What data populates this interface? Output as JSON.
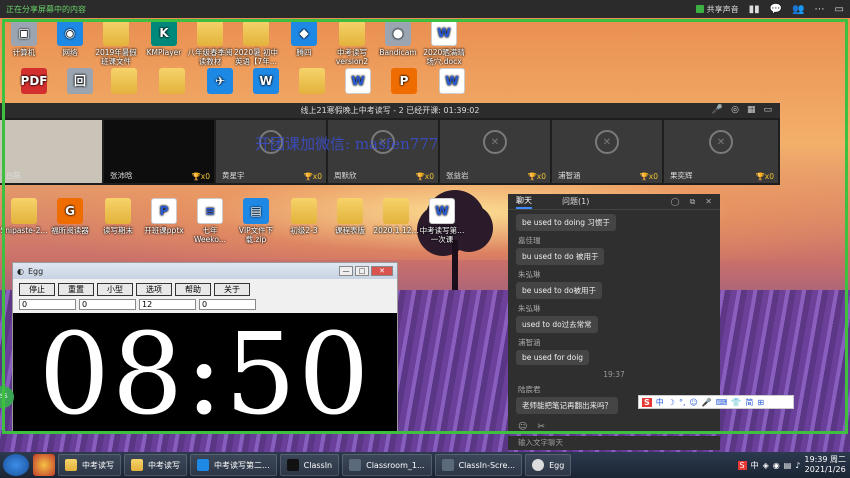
{
  "share_bar": {
    "note": "正在分享屏幕中的内容",
    "sound_label": "共享声音"
  },
  "desktop": {
    "row1": [
      "计算机",
      "网络",
      "2019年暑假班课文件",
      "KMPlayer",
      "八年级春季阅读教材",
      "2020暑 初中英语【7年...",
      "腾四",
      "中考读写version2",
      "Bandicam",
      "2020晒满晴场穴.docx"
    ],
    "row3": [
      "Snipaste-2...",
      "福昕阅读器",
      "读写期末",
      "开班课pptx",
      "七年 Weeko...",
      "VIP文件下载.zip",
      "初级2-3",
      "课程表版",
      "2020.1.12...",
      "中考读写第...一次课"
    ],
    "row2_badges": [
      "PDF",
      "回",
      "W",
      "W"
    ]
  },
  "video": {
    "title": "线上21寒假晚上中考读写 - 2  已经开课: 01:39:02",
    "participants": [
      {
        "name": "白陈",
        "cups": ""
      },
      {
        "name": "张沛晗",
        "cups": "x0"
      },
      {
        "name": "黄星宇",
        "cups": "x0"
      },
      {
        "name": "周默欣",
        "cups": "x0"
      },
      {
        "name": "张益岩",
        "cups": "x0"
      },
      {
        "name": "浦智涵",
        "cups": "x0"
      },
      {
        "name": "",
        "cups": "x0"
      },
      {
        "name": "果奕辉",
        "cups": "x0"
      }
    ]
  },
  "watermark": "开团课加微信: ma⁠sfen777",
  "chat": {
    "tabs": [
      "聊天",
      "问题(1)"
    ],
    "messages": [
      {
        "sender": "",
        "text": "be used to doing  习惯于"
      },
      {
        "sender": "嘉佳瑞",
        "text": "bu used to do 被用于"
      },
      {
        "sender": "朱弘琳",
        "text": "be used to do被用于"
      },
      {
        "sender": "朱弘琳",
        "text": "used to do过去常常"
      },
      {
        "sender": "浦智涵",
        "text": "be used for doig"
      }
    ],
    "time": "19:37",
    "last_sender": "陆宸君",
    "last_text": "老师能把笔记再翻出来吗？",
    "input_placeholder": "输入文字聊天"
  },
  "ime": [
    "中",
    "☽",
    "°,",
    "☺",
    "🎤",
    "⌨",
    "👕",
    "简",
    "⊞"
  ],
  "egg": {
    "title": "Egg",
    "buttons": [
      "停止",
      "重置",
      "小型",
      "选项",
      "帮助",
      "关于"
    ],
    "fields": [
      "0",
      "0",
      "12",
      "0"
    ],
    "clock": "08:50"
  },
  "taskbar": {
    "items": [
      "中考读写",
      "中考读写",
      "中考读写第二...",
      "ClassIn",
      "Classroom_1...",
      "ClassIn-Scre...",
      "Egg"
    ],
    "time": "19:39 周二",
    "date": "2021/1/26"
  },
  "left_badge": "SS"
}
